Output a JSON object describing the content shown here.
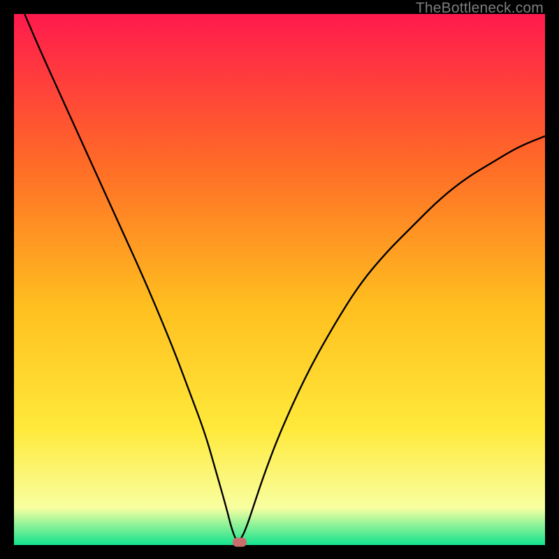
{
  "watermark": {
    "text": "TheBottleneck.com"
  },
  "colors": {
    "frame_bg": "#000000",
    "curve": "#000000",
    "marker": "#cc6d6d",
    "gradient_top": "#ff1a4d",
    "gradient_q1": "#ff6a27",
    "gradient_mid": "#ffbf1f",
    "gradient_q3": "#ffe93a",
    "gradient_near_bottom": "#f8ffa0",
    "gradient_bottom": "#13e38f"
  },
  "chart_data": {
    "type": "line",
    "title": "",
    "xlabel": "",
    "ylabel": "",
    "xlim": [
      0,
      100
    ],
    "ylim": [
      0,
      100
    ],
    "grid": false,
    "legend": false,
    "series": [
      {
        "name": "bottleneck-curve",
        "x": [
          2,
          5,
          10,
          15,
          20,
          25,
          30,
          33,
          36,
          38,
          40,
          41,
          42,
          43,
          44,
          45,
          47,
          50,
          55,
          60,
          65,
          70,
          75,
          80,
          85,
          90,
          95,
          100
        ],
        "y": [
          100,
          93,
          82,
          71,
          60,
          49,
          37,
          29,
          21,
          14,
          7,
          3,
          0.5,
          1.5,
          4,
          7,
          13,
          21,
          32,
          41,
          49,
          55,
          60,
          65,
          69,
          72,
          75,
          77
        ]
      }
    ],
    "marker": {
      "x": 42.5,
      "y": 0.5
    },
    "background": {
      "type": "vertical-gradient",
      "meaning": "red=high bottleneck, green=no bottleneck",
      "stops": [
        {
          "pos": 0.0,
          "color": "#ff1a4d"
        },
        {
          "pos": 0.28,
          "color": "#ff6a27"
        },
        {
          "pos": 0.55,
          "color": "#ffbf1f"
        },
        {
          "pos": 0.78,
          "color": "#ffe93a"
        },
        {
          "pos": 0.93,
          "color": "#f8ffa0"
        },
        {
          "pos": 1.0,
          "color": "#13e38f"
        }
      ]
    }
  }
}
